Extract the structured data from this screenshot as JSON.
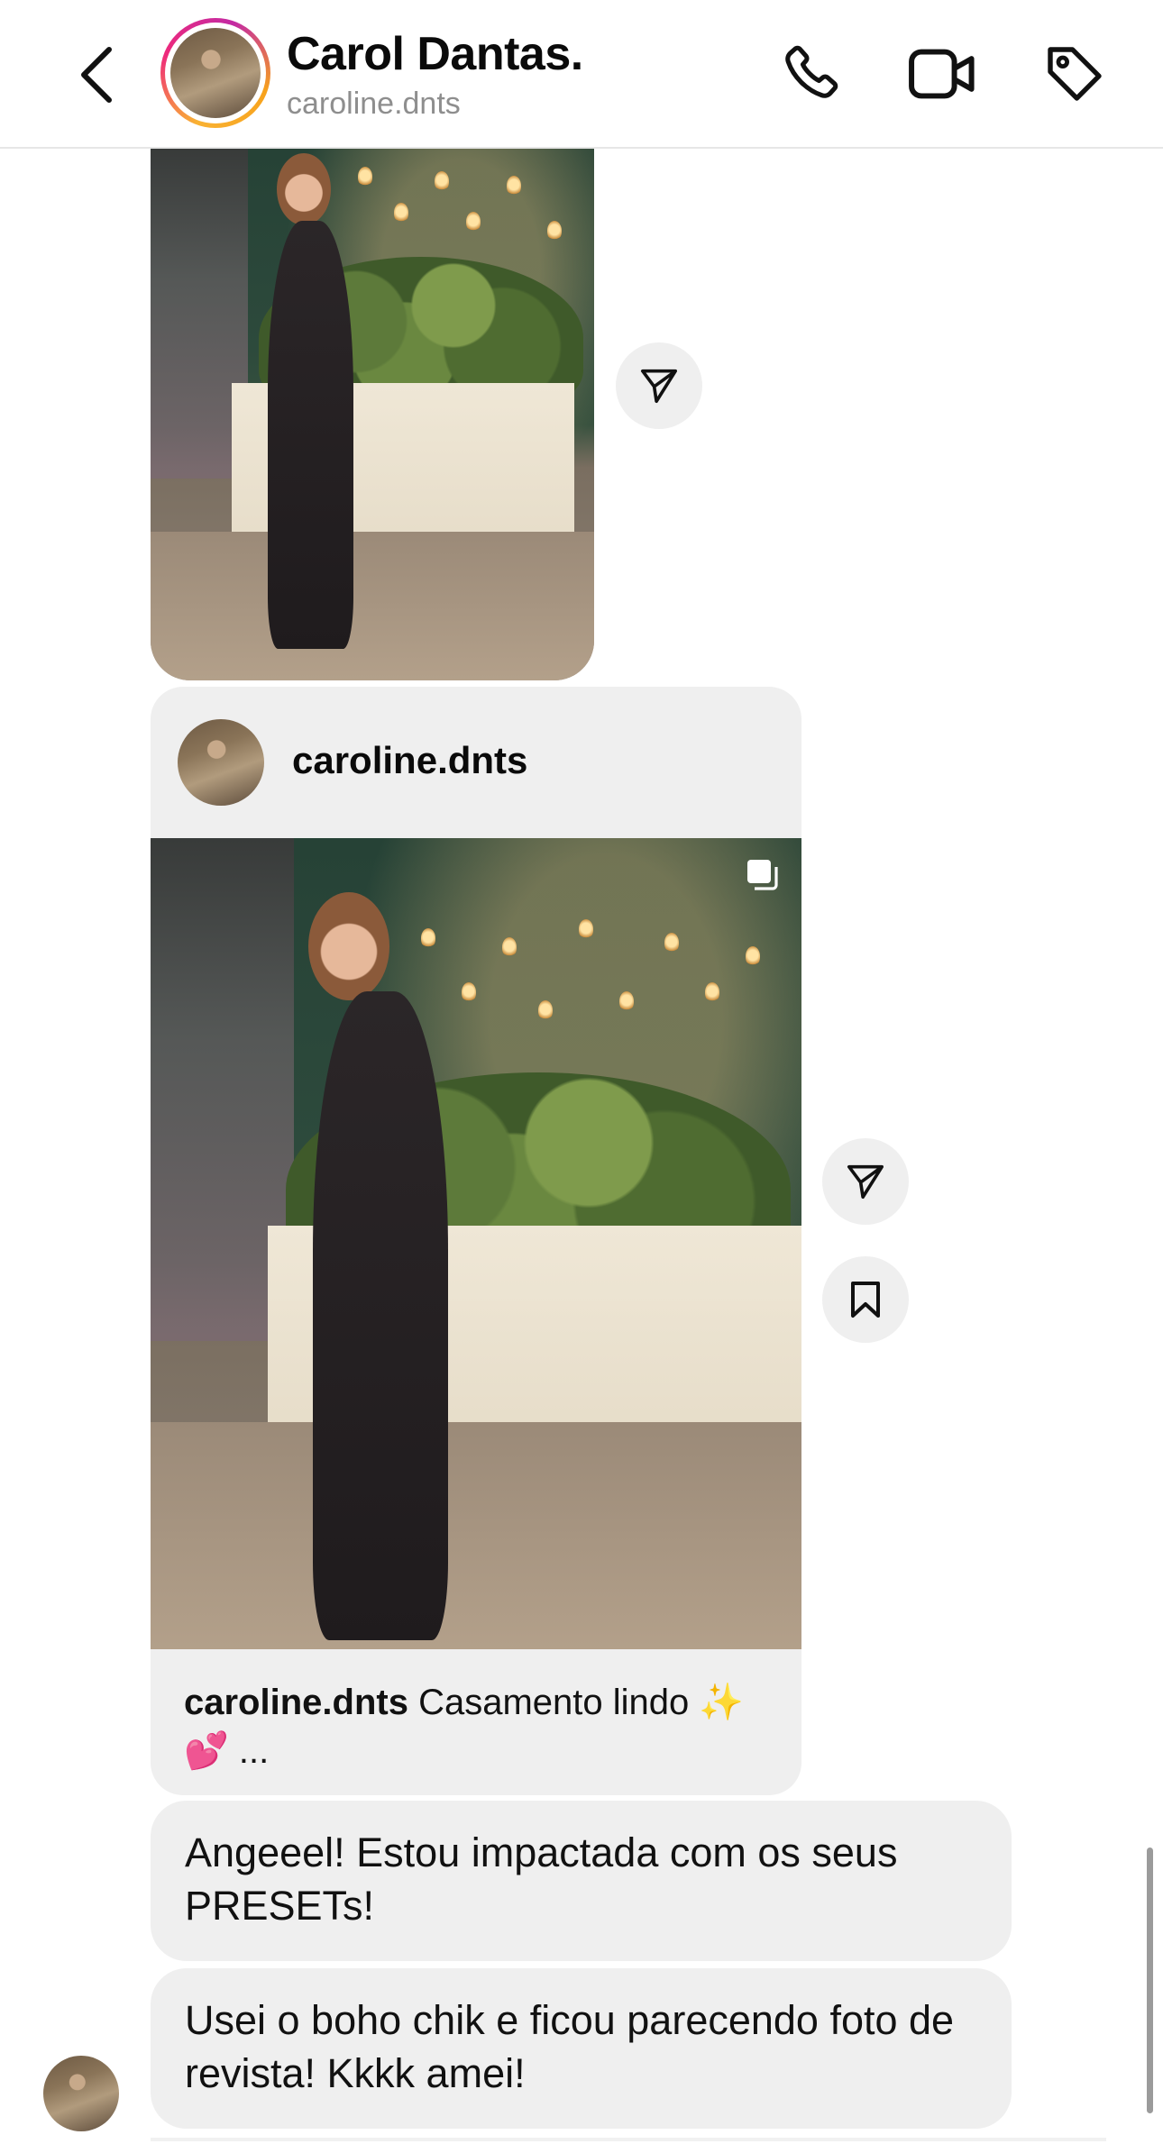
{
  "header": {
    "title": "Carol Dantas.",
    "subtitle": "caroline.dnts",
    "icons": [
      "back-icon",
      "phone-icon",
      "video-icon",
      "tag-icon"
    ]
  },
  "shared_post": {
    "username": "caroline.dnts",
    "caption_user": "caroline.dnts",
    "caption_text": " Casamento lindo ✨💕 ..."
  },
  "messages": [
    {
      "text": "Angeeel! Estou impactada com os seus PRESETs!"
    },
    {
      "text": "Usei o boho chik e ficou parecendo foto de revista! Kkkk amei!"
    }
  ],
  "colors": {
    "bubble": "#efefef",
    "story_ring": [
      "#f9b233",
      "#ee2a7b",
      "#c32aa3"
    ],
    "muted_text": "#8e8e8e"
  }
}
